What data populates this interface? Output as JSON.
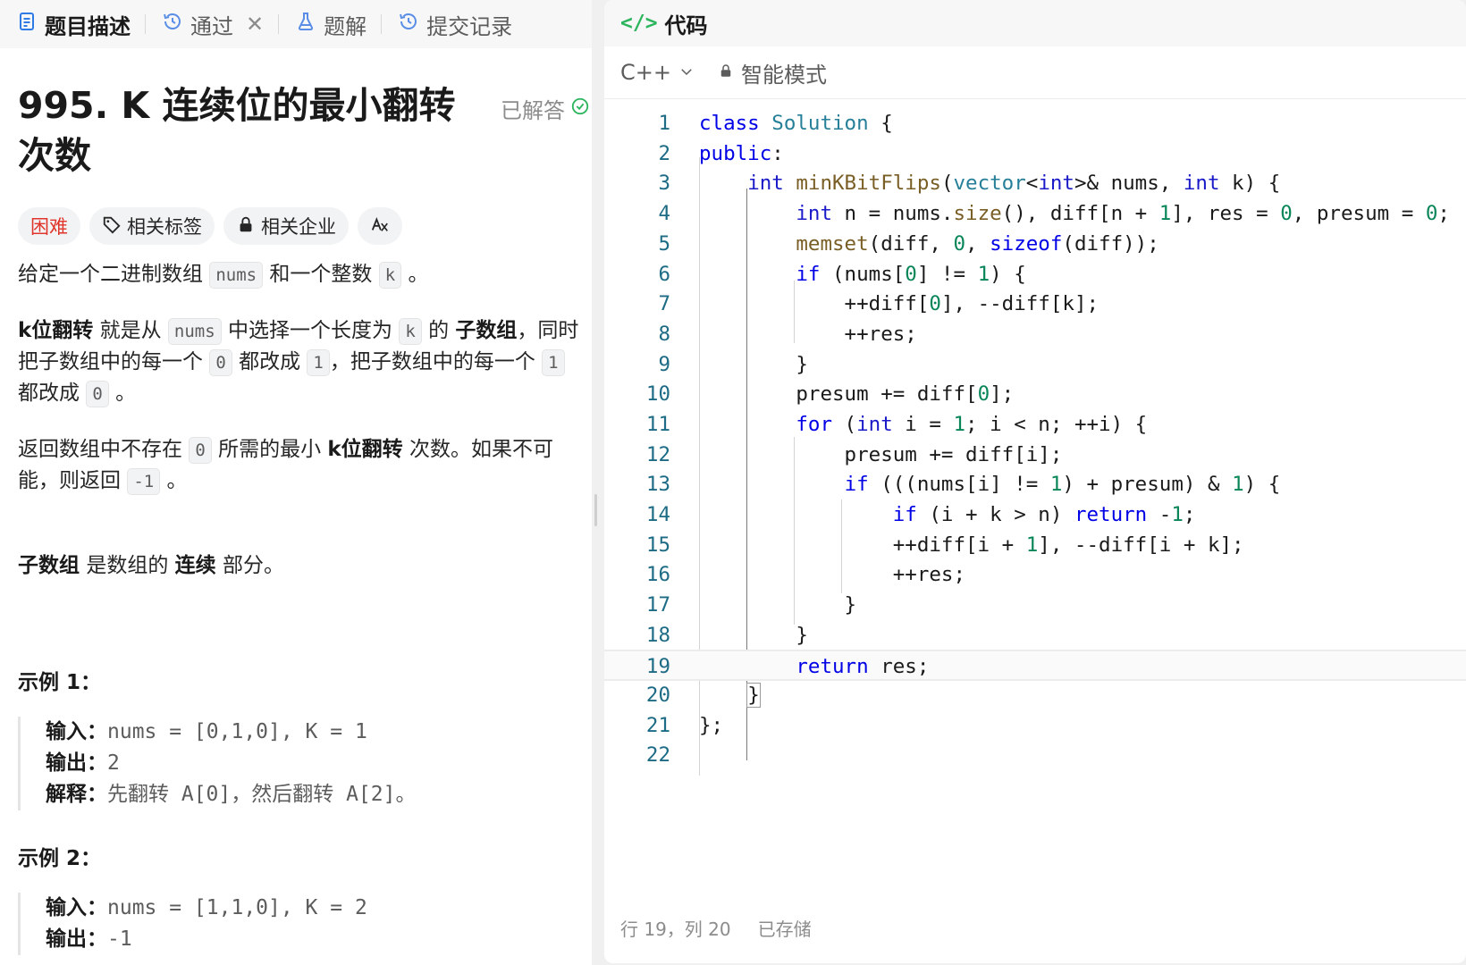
{
  "left_tabs": [
    {
      "label": "题目描述",
      "icon": "description-icon"
    },
    {
      "label": "通过",
      "icon": "history-icon"
    },
    {
      "label": "题解",
      "icon": "flask-icon"
    },
    {
      "label": "提交记录",
      "icon": "history-icon"
    }
  ],
  "problem": {
    "title": "995. K 连续位的最小翻转次数",
    "status": "已解答",
    "tags": {
      "difficulty": "困难",
      "topics": "相关标签",
      "companies": "相关企业"
    },
    "p1": {
      "a": "给定一个二进制数组",
      "nums": "nums",
      "b": "和一个整数",
      "k": "k",
      "c": "。"
    },
    "p2": {
      "bold1": "k位翻转",
      "a": "就是从",
      "nums": "nums",
      "b": "中选择一个长度为",
      "k": "k",
      "c": "的",
      "bold2": "子数组",
      "d": "，同时把子数组中的每一个",
      "zero": "0",
      "e": "都改成",
      "one": "1",
      "f": "，把子数组中的每一个",
      "one2": "1",
      "g": "都改成",
      "zero2": "0",
      "h": "。"
    },
    "p3": {
      "a": "返回数组中不存在",
      "zero": "0",
      "b": "所需的最小",
      "bold": "k位翻转",
      "c": "次数。如果不可能，则返回",
      "neg": "-1",
      "d": "。"
    },
    "p4": {
      "bold1": "子数组",
      "a": "是数组的",
      "bold2": "连续",
      "b": "部分。"
    },
    "examples": [
      {
        "title": "示例 1：",
        "input_label": "输入：",
        "input": "nums = [0,1,0], K = 1",
        "output_label": "输出：",
        "output": "2",
        "explain_label": "解释：",
        "explain": "先翻转 A[0]，然后翻转 A[2]。"
      },
      {
        "title": "示例 2：",
        "input_label": "输入：",
        "input": "nums = [1,1,0], K = 2",
        "output_label": "输出：",
        "output": "-1"
      }
    ]
  },
  "editor": {
    "header": "代码",
    "language": "C++",
    "mode": "智能模式",
    "status_position": "行 19，列 20",
    "status_saved": "已存储",
    "line_numbers": [
      "1",
      "2",
      "3",
      "4",
      "5",
      "6",
      "7",
      "8",
      "9",
      "10",
      "11",
      "12",
      "13",
      "14",
      "15",
      "16",
      "17",
      "18",
      "19",
      "20",
      "21",
      "22"
    ]
  }
}
